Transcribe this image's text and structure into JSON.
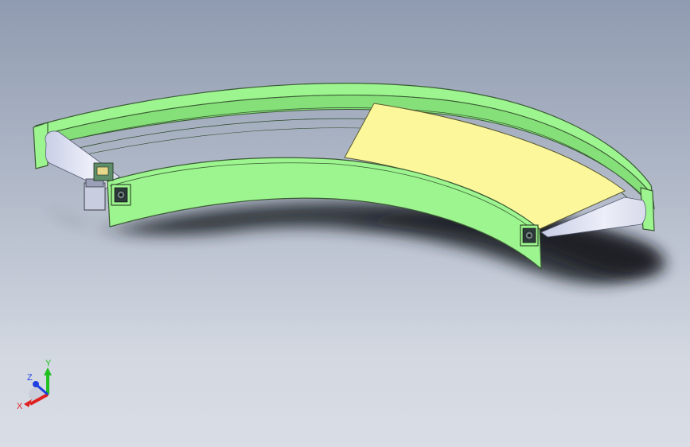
{
  "viewport": {
    "colors": {
      "background_top": "#8f9bb0",
      "background_bottom": "#d9dde5",
      "frame": "#9df58f",
      "frame_edge": "#3a5a34",
      "belt": "#fbf79a",
      "roller_cone": "#dfe3f3",
      "shadow": "#1d1f26"
    }
  },
  "triad": {
    "x_label": "X",
    "y_label": "Y",
    "z_label": "Z",
    "x_color": "#e02020",
    "y_color": "#20c020",
    "z_color": "#2040e0"
  }
}
